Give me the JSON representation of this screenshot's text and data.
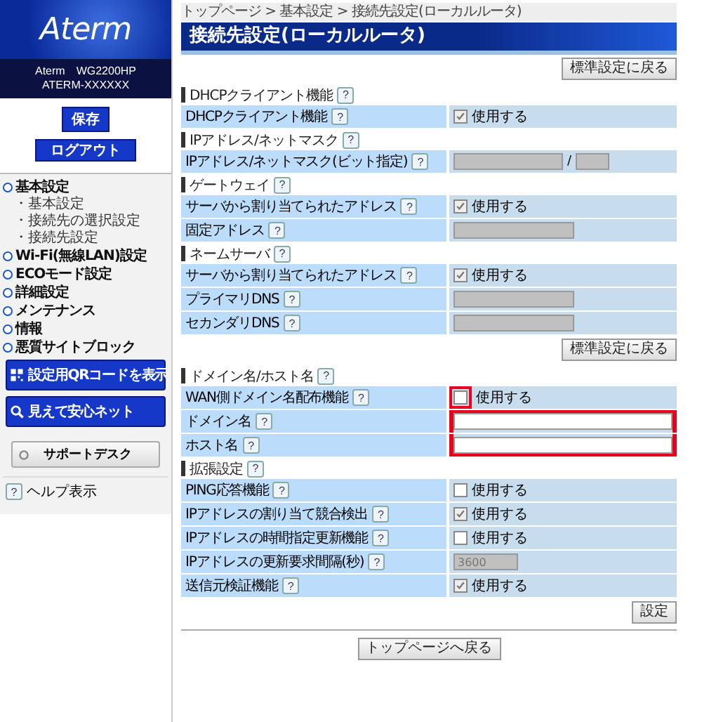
{
  "sidebar": {
    "logo": "Aterm",
    "model": "Aterm　WG2200HP",
    "device": "ATERM-XXXXXX",
    "save_button": "保存",
    "logout_button": "ログアウト",
    "menu": [
      {
        "label": "基本設定",
        "children": [
          {
            "label": "・基本設定"
          },
          {
            "label": "・接続先の選択設定"
          },
          {
            "label": "・接続先設定"
          }
        ]
      },
      {
        "label": "Wi-Fi(無線LAN)設定"
      },
      {
        "label": "ECOモード設定"
      },
      {
        "label": "詳細設定"
      },
      {
        "label": "メンテナンス"
      },
      {
        "label": "情報"
      },
      {
        "label": "悪質サイトブロック"
      }
    ],
    "qr_button": "設定用QRコードを表示",
    "net_button": "見えて安心ネット",
    "support_button": "サポートデスク",
    "help": {
      "icon": "?",
      "label": "ヘルプ表示"
    }
  },
  "main": {
    "breadcrumb": "トップページ > 基本設定 > 接続先設定(ローカルルータ)",
    "title": "接続先設定(ローカルルータ)",
    "reset_button": "標準設定に戻る",
    "sections": [
      {
        "title": "DHCPクライアント機能",
        "help": "?",
        "rows": [
          {
            "label": "DHCPクライアント機能",
            "help": "?",
            "kind": "checkbox",
            "text": "使用する",
            "checked": true
          }
        ]
      },
      {
        "title": "IPアドレス/ネットマスク",
        "help": "?",
        "rows": [
          {
            "label": "IPアドレス/ネットマスク(ビット指定)",
            "help": "?",
            "kind": "ipmask",
            "separator": "/",
            "disabled": true
          }
        ]
      },
      {
        "title": "ゲートウェイ",
        "help": "?",
        "rows": [
          {
            "label": "サーバから割り当てられたアドレス",
            "help": "?",
            "kind": "checkbox",
            "text": "使用する",
            "checked": true
          },
          {
            "label": "固定アドレス",
            "help": "?",
            "kind": "field",
            "disabled": true
          }
        ]
      },
      {
        "title": "ネームサーバ",
        "help": "?",
        "footer_button": "標準設定に戻る",
        "rows": [
          {
            "label": "サーバから割り当てられたアドレス",
            "help": "?",
            "kind": "checkbox",
            "text": "使用する",
            "checked": true
          },
          {
            "label": "プライマリDNS",
            "help": "?",
            "kind": "field",
            "disabled": true
          },
          {
            "label": "セカンダリDNS",
            "help": "?",
            "kind": "field",
            "disabled": true
          }
        ]
      },
      {
        "title": "ドメイン名/ホスト名",
        "help": "?",
        "rows": [
          {
            "label": "WAN側ドメイン名配布機能",
            "help": "?",
            "kind": "checkbox",
            "text": "使用する",
            "checked": false,
            "checkbox_highlight": true
          },
          {
            "label": "ドメイン名",
            "help": "?",
            "kind": "field",
            "disabled": false,
            "highlight": true
          },
          {
            "label": "ホスト名",
            "help": "?",
            "kind": "field",
            "disabled": false,
            "highlight": true
          }
        ]
      },
      {
        "title": "拡張設定",
        "help": "?",
        "footer_button": "設定",
        "rows": [
          {
            "label": "PING応答機能",
            "help": "?",
            "kind": "checkbox",
            "text": "使用する",
            "checked": false
          },
          {
            "label": "IPアドレスの割り当て競合検出",
            "help": "?",
            "kind": "checkbox",
            "text": "使用する",
            "checked": true
          },
          {
            "label": "IPアドレスの時間指定更新機能",
            "help": "?",
            "kind": "checkbox",
            "text": "使用する",
            "checked": false
          },
          {
            "label": "IPアドレスの更新要求間隔(秒)",
            "help": "?",
            "kind": "field",
            "disabled": true,
            "value": "3600",
            "short": true
          },
          {
            "label": "送信元検証機能",
            "help": "?",
            "kind": "checkbox",
            "text": "使用する",
            "checked": true
          }
        ]
      }
    ],
    "top_button": "トップページへ戻る"
  }
}
